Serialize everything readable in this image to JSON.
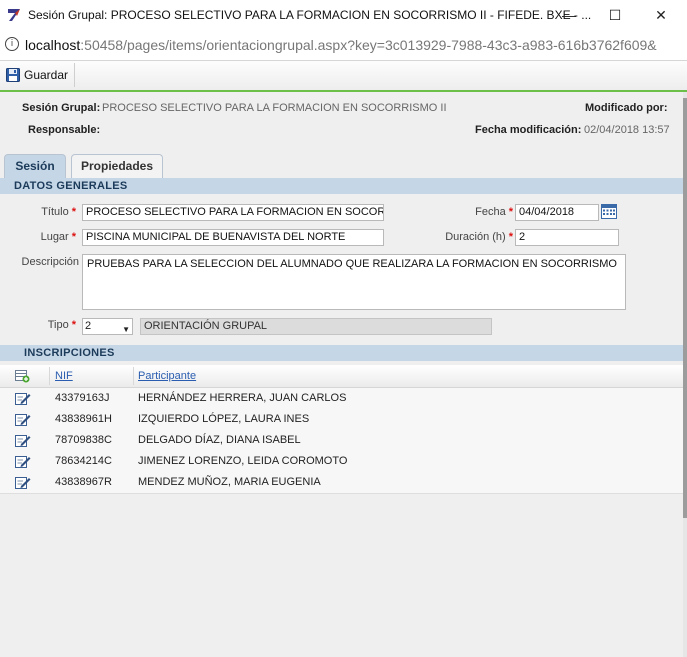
{
  "window": {
    "title": "Sesión Grupal: PROCESO SELECTIVO PARA LA FORMACION EN SOCORRISMO II - FIFEDE. BXE - ...",
    "minimize": "—",
    "maximize": "☐",
    "close": "✕"
  },
  "address": {
    "host": "localhost",
    "rest": ":50458/pages/items/orientaciongrupal.aspx?key=3c013929-7988-43c3-a983-616b3762f609&",
    "info_symbol": "i"
  },
  "toolbar": {
    "save_label": "Guardar"
  },
  "header": {
    "session_label": "Sesión Grupal:",
    "session_value": "PROCESO SELECTIVO PARA LA FORMACION EN SOCORRISMO II",
    "modified_by_label": "Modificado por:",
    "responsible_label": "Responsable:",
    "modified_date_label": "Fecha modificación:",
    "modified_date_value": "02/04/2018 13:57"
  },
  "tabs": [
    {
      "label": "Sesión",
      "active": true
    },
    {
      "label": "Propiedades",
      "active": false
    }
  ],
  "general": {
    "section_title": "DATOS GENERALES",
    "required_mark": "*",
    "titulo_label": "Título",
    "titulo_value": "PROCESO SELECTIVO PARA LA FORMACION EN SOCOR",
    "fecha_label": "Fecha",
    "fecha_value": "04/04/2018",
    "lugar_label": "Lugar",
    "lugar_value": "PISCINA MUNICIPAL DE BUENAVISTA DEL NORTE",
    "duracion_label": "Duración (h)",
    "duracion_value": "2",
    "descripcion_label": "Descripción",
    "descripcion_value": "PRUEBAS PARA LA SELECCION DEL ALUMNADO QUE REALIZARA LA FORMACION EN SOCORRISMO",
    "tipo_label": "Tipo",
    "tipo_value": "2",
    "tipo_desc": "ORIENTACIÓN GRUPAL"
  },
  "inscripciones": {
    "section_title": "INSCRIPCIONES",
    "col_nif": "NIF",
    "col_participante": "Participante",
    "rows": [
      {
        "nif": "43379163J",
        "participante": "HERNÁNDEZ HERRERA, JUAN CARLOS"
      },
      {
        "nif": "43838961H",
        "participante": "IZQUIERDO LÓPEZ, LAURA INES"
      },
      {
        "nif": "78709838C",
        "participante": "DELGADO DÍAZ, DIANA ISABEL"
      },
      {
        "nif": "78634214C",
        "participante": "JIMENEZ LORENZO, LEIDA COROMOTO"
      },
      {
        "nif": "43838967R",
        "participante": "MENDEZ MUÑOZ, MARIA EUGENIA"
      }
    ]
  },
  "colors": {
    "accent_green": "#6cc04a",
    "section_blue": "#c5d6e6",
    "link_blue": "#2a5db0",
    "required_red": "#d11111"
  }
}
